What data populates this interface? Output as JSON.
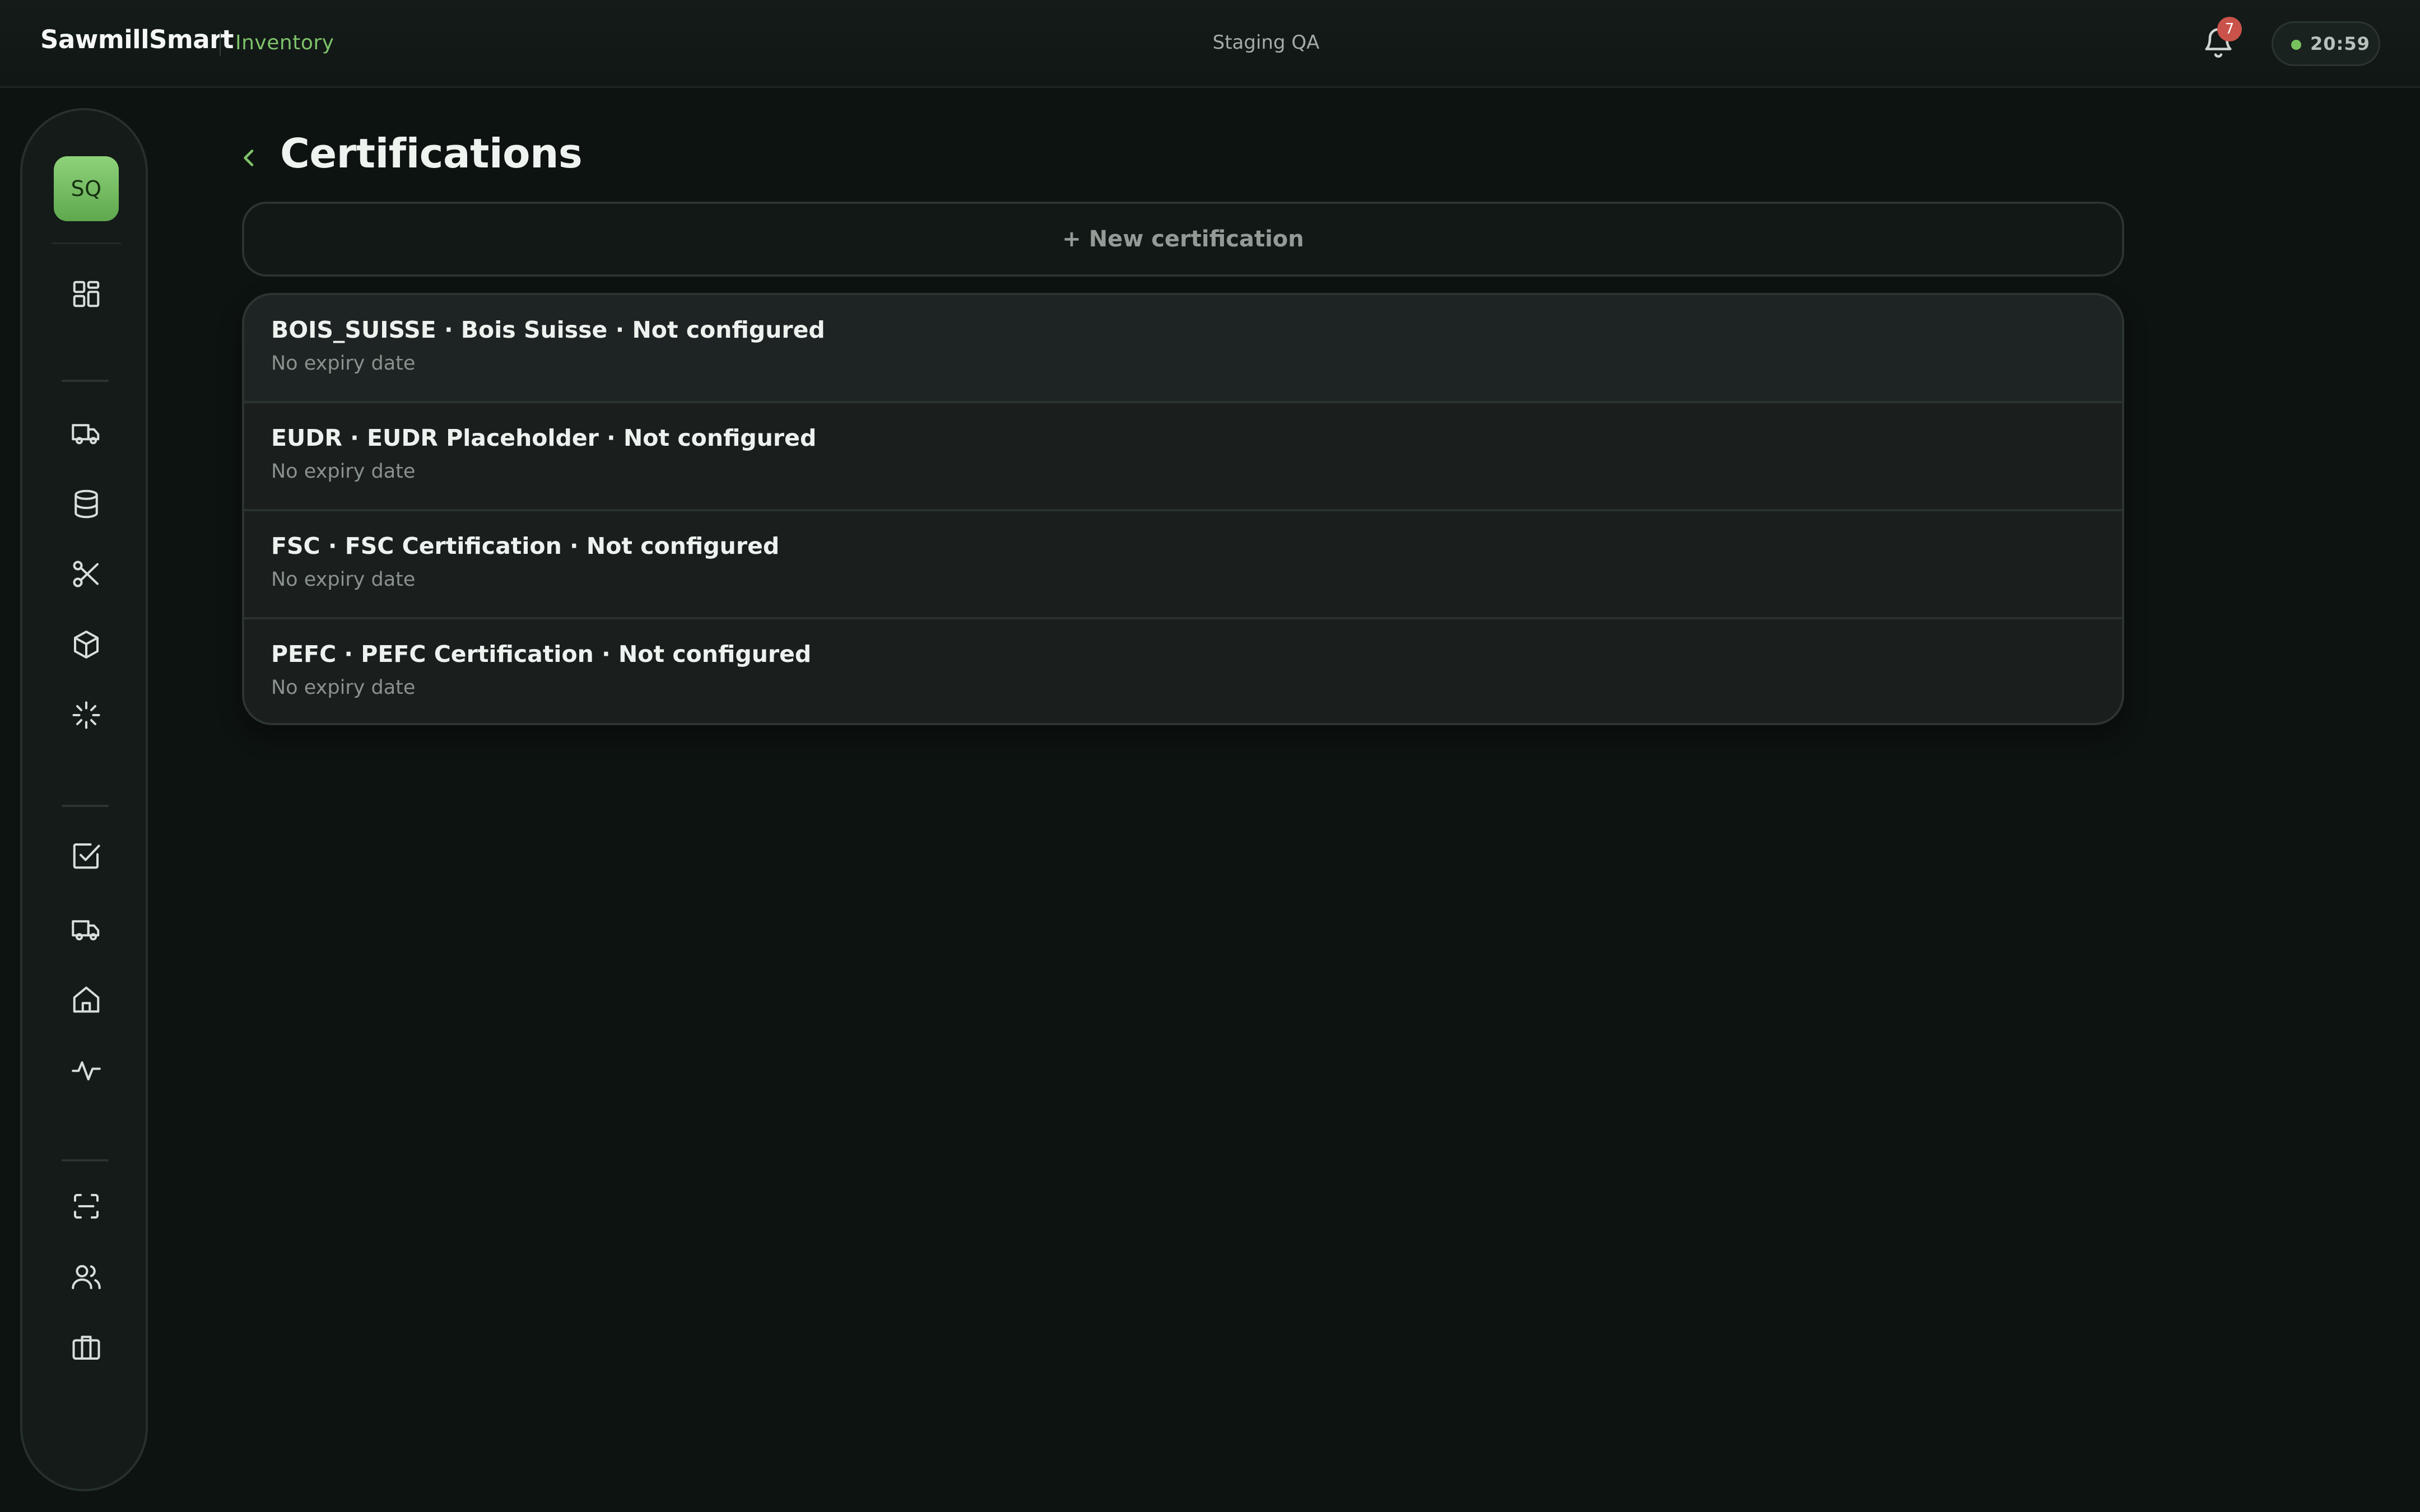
{
  "header": {
    "brand": "SawmillSmart",
    "section": "Inventory",
    "environment": "Staging QA",
    "notification_count": "7",
    "clock": "20:59",
    "status_color": "#78c25e"
  },
  "sidebar": {
    "avatar_initials": "SQ",
    "items": [
      {
        "icon": "dashboard-icon"
      },
      {
        "icon": "truck-icon"
      },
      {
        "icon": "database-icon"
      },
      {
        "icon": "scissors-icon"
      },
      {
        "icon": "box-icon"
      },
      {
        "icon": "sparkle-icon"
      },
      {
        "icon": "checkbox-icon"
      },
      {
        "icon": "delivery-truck-icon"
      },
      {
        "icon": "home-icon"
      },
      {
        "icon": "activity-icon"
      },
      {
        "icon": "scan-icon"
      },
      {
        "icon": "users-icon"
      },
      {
        "icon": "briefcase-icon"
      }
    ]
  },
  "main": {
    "title": "Certifications",
    "new_button": "+ New certification",
    "certifications": [
      {
        "title": "BOIS_SUISSE · Bois Suisse · Not configured",
        "subtitle": "No expiry date"
      },
      {
        "title": "EUDR · EUDR Placeholder · Not configured",
        "subtitle": "No expiry date"
      },
      {
        "title": "FSC · FSC Certification · Not configured",
        "subtitle": "No expiry date"
      },
      {
        "title": "PEFC · PEFC Certification · Not configured",
        "subtitle": "No expiry date"
      }
    ]
  },
  "colors": {
    "accent": "#7fc36a",
    "badge": "#c9534a",
    "background": "#0d1311"
  }
}
